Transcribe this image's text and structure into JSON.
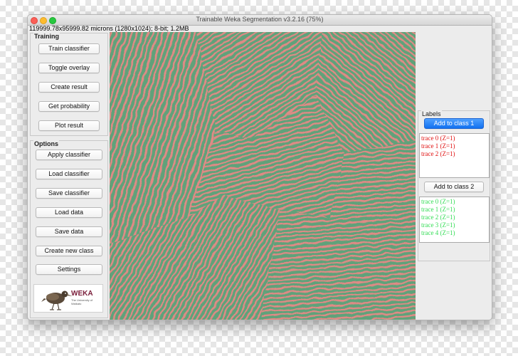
{
  "window": {
    "title": "Trainable Weka Segmentation v3.2.16 (75%)",
    "info": "119999.78x95999.82 microns (1280x1024); 8-bit; 1.2MB"
  },
  "training": {
    "title": "Training",
    "buttons": [
      "Train classifier",
      "Toggle overlay",
      "Create result",
      "Get probability",
      "Plot result"
    ]
  },
  "options": {
    "title": "Options",
    "buttons": [
      "Apply classifier",
      "Load classifier",
      "Save classifier",
      "Load data",
      "Save data",
      "Create new class",
      "Settings"
    ]
  },
  "labels": {
    "title": "Labels",
    "class1": {
      "button": "Add to class 1",
      "color": "#ff0000",
      "traces": [
        "trace 0 (Z=1)",
        "trace 1 (Z=1)",
        "trace 2 (Z=1)"
      ]
    },
    "class2": {
      "button": "Add to class 2",
      "color": "#33dd55",
      "traces": [
        "trace 0 (Z=1)",
        "trace 1 (Z=1)",
        "trace 2 (Z=1)",
        "trace 3 (Z=1)",
        "trace 4 (Z=1)"
      ]
    }
  },
  "logo": {
    "name": "WEKA",
    "subtitle": "The University of Waikato"
  },
  "colors": {
    "overlay_red": "#e08a85",
    "overlay_green": "#5fa27a",
    "primary_button": "#1271f0"
  }
}
